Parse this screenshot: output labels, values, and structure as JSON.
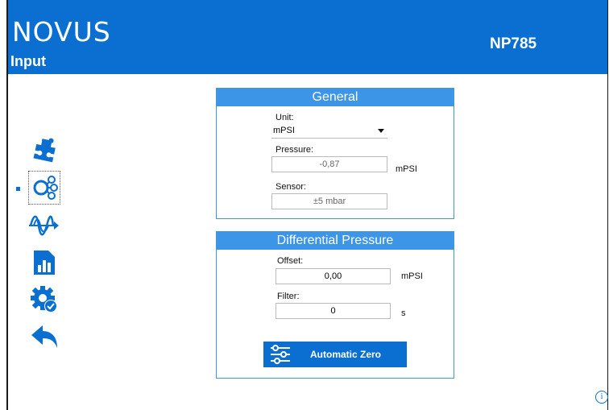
{
  "header": {
    "logo": "NOVUS",
    "title": "Input",
    "model": "NP785"
  },
  "nav": [
    {
      "name": "settings-puzzle-icon",
      "active": false
    },
    {
      "name": "input-network-icon",
      "active": true
    },
    {
      "name": "signal-wave-icon",
      "active": false
    },
    {
      "name": "bar-chart-icon",
      "active": false
    },
    {
      "name": "gear-check-icon",
      "active": false
    },
    {
      "name": "back-arrow-icon",
      "active": false
    }
  ],
  "general": {
    "title": "General",
    "unit_label": "Unit:",
    "unit_value": "mPSI",
    "pressure_label": "Pressure:",
    "pressure_value": "-0,87",
    "pressure_unit": "mPSI",
    "sensor_label": "Sensor:",
    "sensor_value": "±5 mbar"
  },
  "differential": {
    "title": "Differential Pressure",
    "offset_label": "Offset:",
    "offset_value": "0,00",
    "offset_unit": "mPSI",
    "filter_label": "Filter:",
    "filter_value": "0",
    "filter_unit": "s",
    "zero_button": "Automatic Zero"
  },
  "footer": {
    "info": "i"
  },
  "colors": {
    "brand": "#0a6fd1",
    "panel_header": "#3d95e8"
  }
}
